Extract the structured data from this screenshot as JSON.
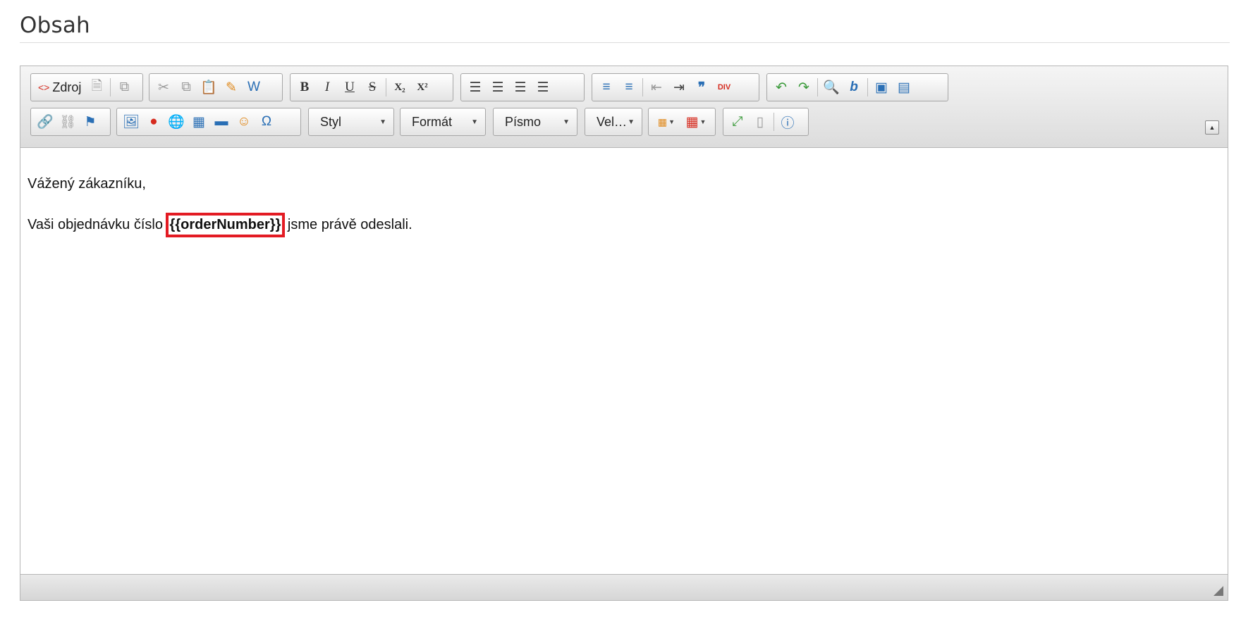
{
  "page": {
    "title": "Obsah"
  },
  "toolbar": {
    "row1": {
      "source_label": "Zdroj"
    },
    "combos": {
      "style": "Styl",
      "format": "Formát",
      "font": "Písmo",
      "size": "Vel…"
    },
    "icons": {
      "bold": "B",
      "italic": "I",
      "underline": "U",
      "strike": "S",
      "subscript": "X₂",
      "superscript": "X²",
      "omega": "Ω",
      "blockquote": "❞",
      "div": "DIV"
    }
  },
  "content": {
    "greeting": "Vážený zákazníku,",
    "line_before": "Vaši objednávku číslo ",
    "placeholder": "{{orderNumber}}",
    "line_after": " jsme právě odeslali."
  },
  "colors": {
    "highlight": "#e31b23"
  }
}
